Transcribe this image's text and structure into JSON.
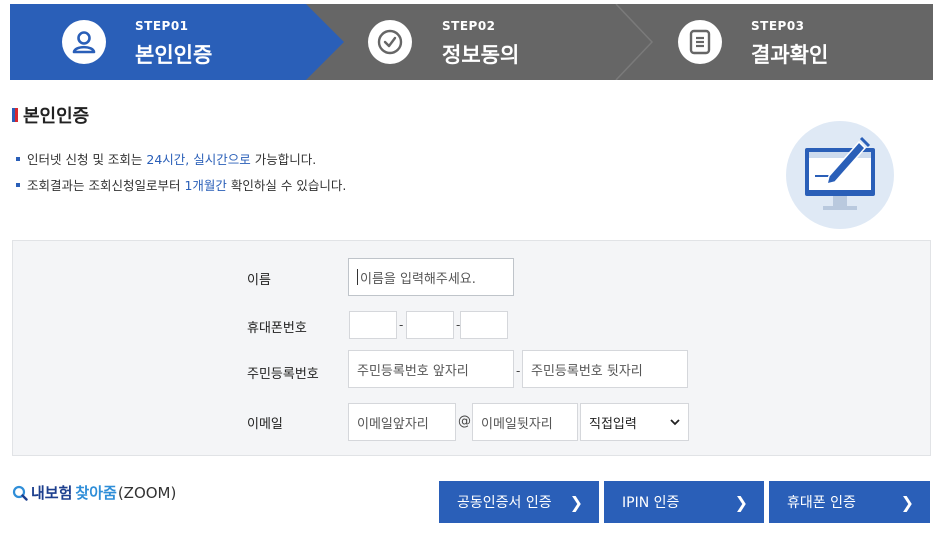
{
  "steps": [
    {
      "num": "STEP01",
      "name": "본인인증",
      "icon": "person-icon",
      "active": true
    },
    {
      "num": "STEP02",
      "name": "정보동의",
      "icon": "check-circle-icon",
      "active": false
    },
    {
      "num": "STEP03",
      "name": "결과확인",
      "icon": "document-icon",
      "active": false
    }
  ],
  "section": {
    "title": "본인인증"
  },
  "notices": [
    {
      "before": "인터넷 신청 및 조회는 ",
      "highlight": "24시간, 실시간으로",
      "after": " 가능합니다."
    },
    {
      "before": "조회결과는 조회신청일로부터 ",
      "highlight": "1개월간",
      "after": " 확인하실 수 있습니다."
    }
  ],
  "form": {
    "name_label": "이름",
    "name_placeholder": "이름을 입력해주세요.",
    "phone_label": "휴대폰번호",
    "phone_dash": "-",
    "rrn_label": "주민등록번호",
    "rrn_front_placeholder": "주민등록번호 앞자리",
    "rrn_back_placeholder": "주민등록번호 뒷자리",
    "rrn_dash": "-",
    "email_label": "이메일",
    "email_id_placeholder": "이메일앞자리",
    "email_at": "@",
    "email_domain_placeholder": "이메일뒷자리",
    "email_domain_select": "직접입력"
  },
  "zoom": {
    "part1": "내보험",
    "part2": "찾아줌",
    "part3": "(ZOOM)"
  },
  "buttons": {
    "cert": "공동인증서 인증",
    "ipin": "IPIN 인증",
    "phone": "휴대폰 인증",
    "chevron": "❯"
  },
  "colors": {
    "primary": "#2a5fb8",
    "inactive_step": "#666666",
    "accent_red": "#d8282f"
  }
}
